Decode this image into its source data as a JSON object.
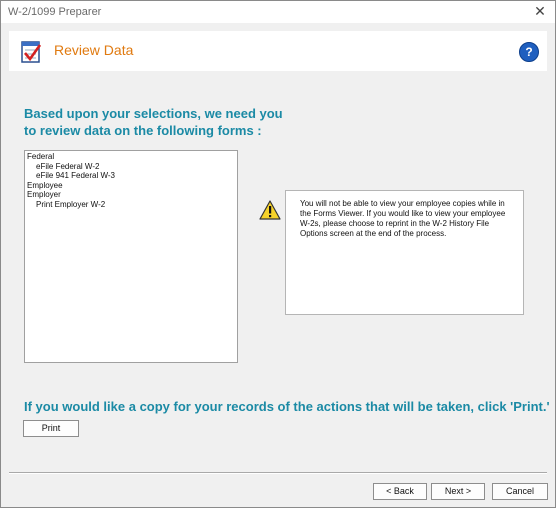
{
  "window": {
    "title": "W-2/1099 Preparer",
    "close_glyph": "✕"
  },
  "header": {
    "title": "Review Data",
    "icon": "checklist-icon",
    "help_glyph": "?"
  },
  "intro": {
    "line1": "Based upon your selections, we need you",
    "line2": "to review data on the following forms :"
  },
  "forms_list": {
    "items": [
      {
        "label": "Federal",
        "indent": 0
      },
      {
        "label": "eFile Federal W-2",
        "indent": 1
      },
      {
        "label": "eFile 941 Federal W-3",
        "indent": 1
      },
      {
        "label": "Employee",
        "indent": 0
      },
      {
        "label": "Employer",
        "indent": 0
      },
      {
        "label": "Print Employer W-2",
        "indent": 1
      }
    ]
  },
  "notice": {
    "icon": "warning-icon",
    "text": "You will not be able to view your employee copies while in the Forms Viewer. If you would like to view your employee W-2s, please choose to reprint in the W-2 History File Options screen at the end of the process."
  },
  "copy_message": "If you would like a copy for your records of the actions that will be taken, click 'Print.'",
  "buttons": {
    "print": "Print",
    "back": "< Back",
    "next": "Next >",
    "cancel": "Cancel"
  },
  "colors": {
    "accent_teal": "#1b8aa5",
    "header_orange": "#e07a10",
    "help_blue": "#1f5fbf",
    "warning_yellow": "#f6d22a"
  }
}
